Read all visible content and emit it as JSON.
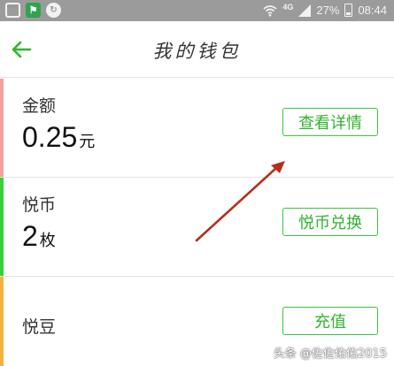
{
  "status_bar": {
    "network": "4G",
    "battery": "27%",
    "time": "08:44"
  },
  "header": {
    "title": "我的钱包"
  },
  "cards": [
    {
      "label": "金额",
      "value": "0.25",
      "unit": "元",
      "button": "查看详情",
      "accent": "#f2a0a0"
    },
    {
      "label": "悦币",
      "value": "2",
      "unit": "枚",
      "button": "悦币兑换",
      "accent": "#36d136"
    },
    {
      "label": "悦豆",
      "value": "",
      "unit": "",
      "button": "充值",
      "accent": "#f5b23a"
    }
  ],
  "colors": {
    "button_green": "#2fb42f",
    "arrow": "#b5301c",
    "status_bar_bg": "#9b9b9b"
  },
  "icons": {
    "back": "arrow-left-icon",
    "status": [
      "gallery-icon",
      "flag-icon",
      "refresh-icon",
      "wifi-icon",
      "signal-icon",
      "battery-icon"
    ]
  },
  "watermark": "头条 @佐佐佑佑2015"
}
